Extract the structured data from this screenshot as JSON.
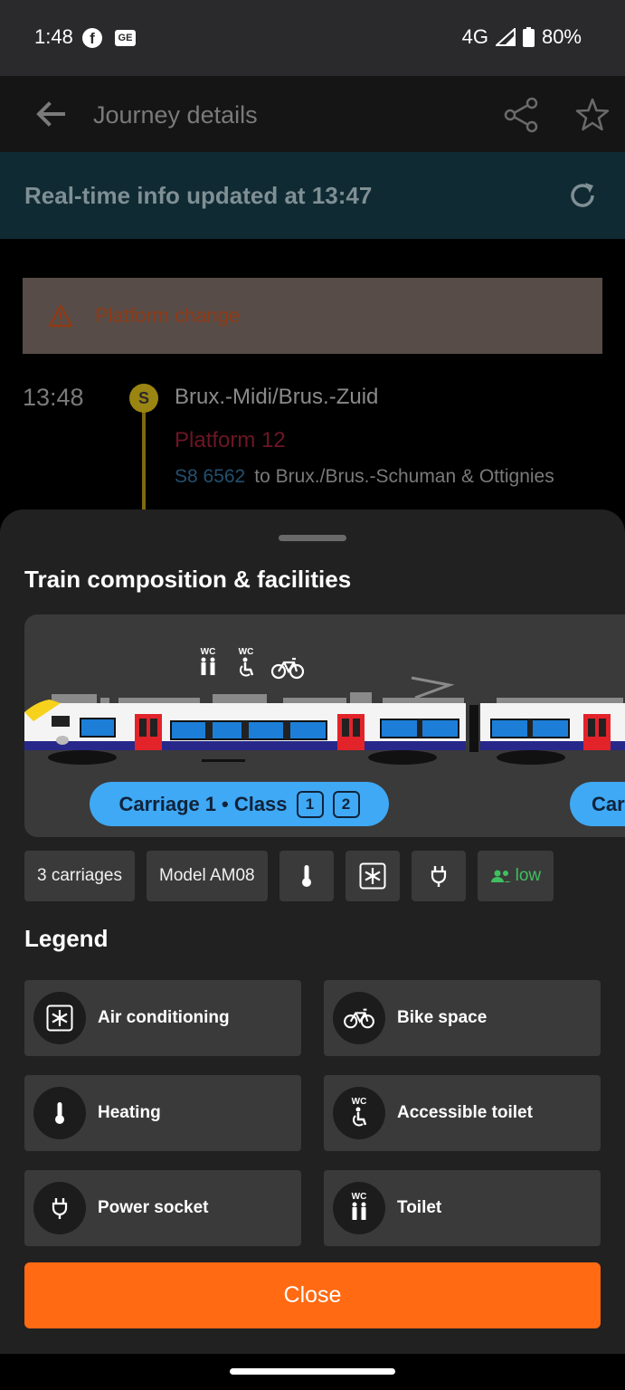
{
  "status": {
    "time": "1:48",
    "network": "4G",
    "battery": "80%"
  },
  "appbar": {
    "title": "Journey details"
  },
  "realtime": {
    "text": "Real-time info updated at 13:47"
  },
  "alert": {
    "text": "Platform change"
  },
  "departure": {
    "time": "13:48",
    "station": "Brux.-Midi/Brus.-Zuid",
    "platform": "Platform 12",
    "train_number": "S8 6562",
    "destination": "to Brux./Brus.-Schuman & Ottignies",
    "line_badge": "S"
  },
  "sheet": {
    "title": "Train composition & facilities",
    "carriage_pill": {
      "carriage_label": "Carriage",
      "carriage_num": "1",
      "class_label": "• Class",
      "classes": [
        "1",
        "2"
      ]
    },
    "next_carriage_label": "Car",
    "wc_text": "WC",
    "chips": {
      "carriages": "3 carriages",
      "model": "Model AM08",
      "occupancy": "low"
    },
    "legend_title": "Legend",
    "legend": [
      {
        "label": "Air conditioning",
        "icon": "snowflake-icon"
      },
      {
        "label": "Bike space",
        "icon": "bike-icon"
      },
      {
        "label": "Heating",
        "icon": "thermometer-icon"
      },
      {
        "label": "Accessible toilet",
        "icon": "accessible-toilet-icon"
      },
      {
        "label": "Power socket",
        "icon": "plug-icon"
      },
      {
        "label": "Toilet",
        "icon": "toilet-icon"
      }
    ],
    "close_label": "Close"
  },
  "colors": {
    "accent": "#ff6a13",
    "pill": "#3fa9f5",
    "occupancy_low": "#3fbf5f",
    "platform": "#6d1624"
  }
}
